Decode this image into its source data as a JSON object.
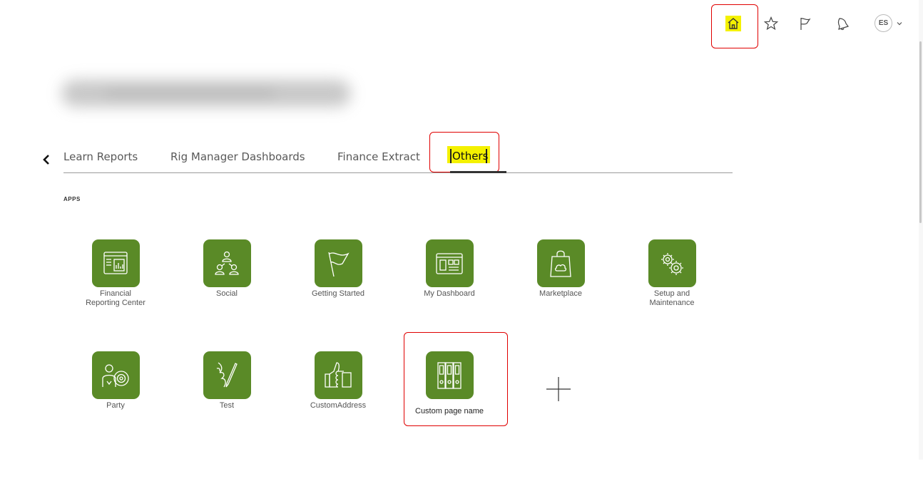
{
  "header": {
    "home_icon": "home-icon",
    "favorites_icon": "star-icon",
    "watchlist_icon": "flag-icon",
    "notifications_icon": "bell-icon",
    "user_initials": "ES",
    "highlight_color": "#f4f100",
    "annotation_color": "#e00000"
  },
  "tabs": {
    "items": [
      {
        "label": "Learn Reports"
      },
      {
        "label": "Rig Manager Dashboards"
      },
      {
        "label": "Finance Extract"
      },
      {
        "label": "Others"
      }
    ],
    "active": "Others"
  },
  "apps": {
    "heading": "APPS",
    "tile_color": "#5a8a27",
    "items": [
      {
        "label": "Financial\nReporting Center",
        "icon": "report-icon"
      },
      {
        "label": "Social",
        "icon": "people-network-icon"
      },
      {
        "label": "Getting Started",
        "icon": "flag-icon"
      },
      {
        "label": "My Dashboard",
        "icon": "dashboard-icon"
      },
      {
        "label": "Marketplace",
        "icon": "shopping-bag-icon"
      },
      {
        "label": "Setup and\nMaintenance",
        "icon": "gears-icon"
      },
      {
        "label": "Party",
        "icon": "party-icon"
      },
      {
        "label": "Test",
        "icon": "pen-icon"
      },
      {
        "label": "CustomAddress",
        "icon": "thumbs-up-icon"
      },
      {
        "label": "Custom page name",
        "icon": "binders-icon"
      }
    ],
    "add_icon": "plus-icon"
  }
}
